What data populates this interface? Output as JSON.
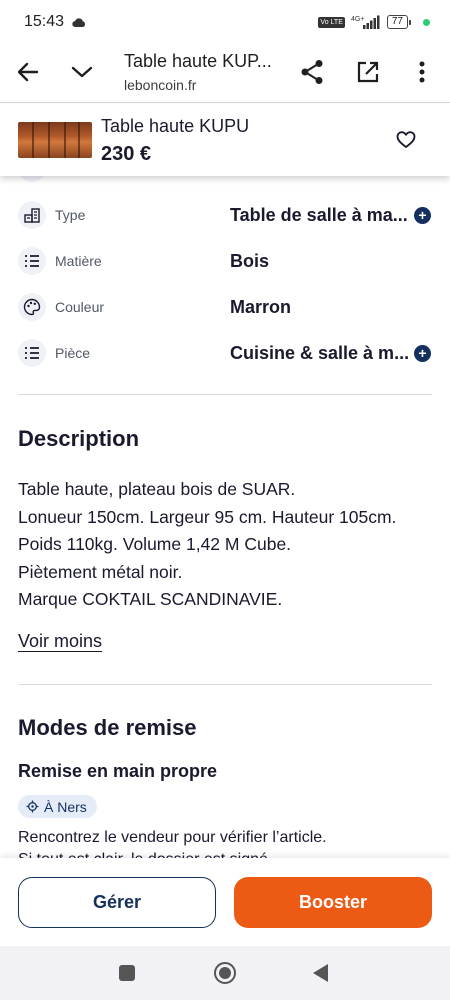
{
  "status_bar": {
    "time": "15:43",
    "network": "4G+",
    "volte": "Vo LTE",
    "battery": "77"
  },
  "browser": {
    "title": "Table haute KUP...",
    "domain": "leboncoin.fr",
    "icons": [
      "back-arrow-icon",
      "chevron-down-icon",
      "share-icon",
      "open-external-icon",
      "more-vert-icon"
    ]
  },
  "sticky_ad": {
    "title": "Table haute KUPU",
    "price": "230 €"
  },
  "attributes": [
    {
      "icon": "furniture-type-icon",
      "label": "Type",
      "value": "Table de salle à ma...",
      "has_plus": true
    },
    {
      "icon": "list-icon",
      "label": "Matière",
      "value": "Bois",
      "has_plus": false
    },
    {
      "icon": "palette-icon",
      "label": "Couleur",
      "value": "Marron",
      "has_plus": false
    },
    {
      "icon": "list-icon",
      "label": "Pièce",
      "value": "Cuisine & salle à m...",
      "has_plus": true
    }
  ],
  "description": {
    "title": "Description",
    "lines": [
      "Table haute, plateau bois de SUAR.",
      "Lonueur 150cm. Largeur 95 cm. Hauteur 105cm.",
      "Poids 110kg. Volume 1,42 M Cube.",
      "Piètement métal noir.",
      "Marque COKTAIL SCANDINAVIE."
    ],
    "toggle_label": "Voir moins"
  },
  "delivery": {
    "title": "Modes de remise",
    "subtitle": "Remise en main propre",
    "location": "À Ners",
    "text": "Rencontrez le vendeur pour vérifier l’article.",
    "text_cut": "Si tout est clair, le dossier est signé..."
  },
  "actions": {
    "manage_label": "Gérer",
    "boost_label": "Booster"
  },
  "colors": {
    "primary_navy": "#14305e",
    "accent_orange": "#ec5a13",
    "chip_bg": "#e4ecf8"
  }
}
